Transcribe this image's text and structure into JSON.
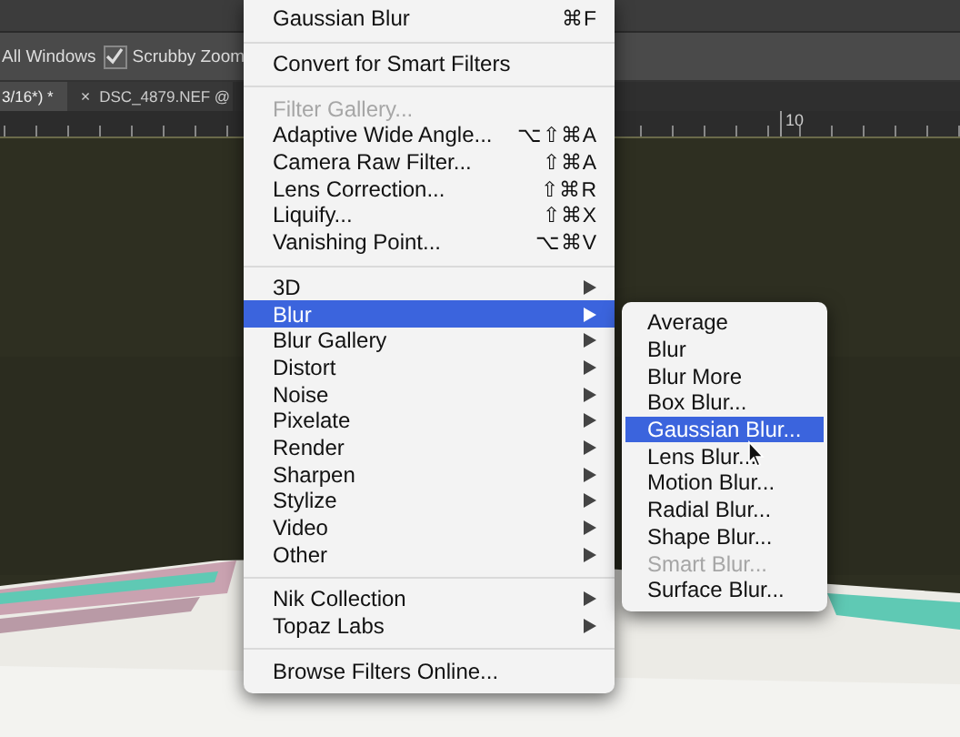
{
  "options_bar": {
    "label": "All Windows",
    "scrubby_zoom": {
      "label": "Scrubby Zoom",
      "checked": true
    }
  },
  "tabs": [
    {
      "label": "3/16*) *",
      "selected": true
    },
    {
      "close": "×",
      "label": "DSC_4879.NEF @",
      "selected": false
    }
  ],
  "ruler": {
    "label": "10"
  },
  "menu": {
    "sections": [
      [
        {
          "label": "Gaussian Blur",
          "shortcut": "⌘F",
          "submenu": false,
          "disabled": false,
          "selected": false
        }
      ],
      [
        {
          "label": "Convert for Smart Filters",
          "submenu": false,
          "disabled": false,
          "selected": false
        }
      ],
      [
        {
          "label": "Filter Gallery...",
          "submenu": false,
          "disabled": true,
          "selected": false
        },
        {
          "label": "Adaptive Wide Angle...",
          "shortcut": "⌥⇧⌘A",
          "submenu": false,
          "disabled": false,
          "selected": false
        },
        {
          "label": "Camera Raw Filter...",
          "shortcut": "⇧⌘A",
          "submenu": false,
          "disabled": false,
          "selected": false
        },
        {
          "label": "Lens Correction...",
          "shortcut": "⇧⌘R",
          "submenu": false,
          "disabled": false,
          "selected": false
        },
        {
          "label": "Liquify...",
          "shortcut": "⇧⌘X",
          "submenu": false,
          "disabled": false,
          "selected": false
        },
        {
          "label": "Vanishing Point...",
          "shortcut": "⌥⌘V",
          "submenu": false,
          "disabled": false,
          "selected": false
        }
      ],
      [
        {
          "label": "3D",
          "submenu": true,
          "disabled": false,
          "selected": false
        },
        {
          "label": "Blur",
          "submenu": true,
          "disabled": false,
          "selected": true
        },
        {
          "label": "Blur Gallery",
          "submenu": true,
          "disabled": false,
          "selected": false
        },
        {
          "label": "Distort",
          "submenu": true,
          "disabled": false,
          "selected": false
        },
        {
          "label": "Noise",
          "submenu": true,
          "disabled": false,
          "selected": false
        },
        {
          "label": "Pixelate",
          "submenu": true,
          "disabled": false,
          "selected": false
        },
        {
          "label": "Render",
          "submenu": true,
          "disabled": false,
          "selected": false
        },
        {
          "label": "Sharpen",
          "submenu": true,
          "disabled": false,
          "selected": false
        },
        {
          "label": "Stylize",
          "submenu": true,
          "disabled": false,
          "selected": false
        },
        {
          "label": "Video",
          "submenu": true,
          "disabled": false,
          "selected": false
        },
        {
          "label": "Other",
          "submenu": true,
          "disabled": false,
          "selected": false
        }
      ],
      [
        {
          "label": "Nik Collection",
          "submenu": true,
          "disabled": false,
          "selected": false
        },
        {
          "label": "Topaz Labs",
          "submenu": true,
          "disabled": false,
          "selected": false
        }
      ],
      [
        {
          "label": "Browse Filters Online...",
          "submenu": false,
          "disabled": false,
          "selected": false
        }
      ]
    ]
  },
  "submenu": {
    "items": [
      {
        "label": "Average",
        "disabled": false,
        "selected": false
      },
      {
        "label": "Blur",
        "disabled": false,
        "selected": false
      },
      {
        "label": "Blur More",
        "disabled": false,
        "selected": false
      },
      {
        "label": "Box Blur...",
        "disabled": false,
        "selected": false
      },
      {
        "label": "Gaussian Blur...",
        "disabled": false,
        "selected": true
      },
      {
        "label": "Lens Blur...",
        "disabled": false,
        "selected": false
      },
      {
        "label": "Motion Blur...",
        "disabled": false,
        "selected": false
      },
      {
        "label": "Radial Blur...",
        "disabled": false,
        "selected": false
      },
      {
        "label": "Shape Blur...",
        "disabled": false,
        "selected": false
      },
      {
        "label": "Smart Blur...",
        "disabled": true,
        "selected": false
      },
      {
        "label": "Surface Blur...",
        "disabled": false,
        "selected": false
      }
    ]
  }
}
